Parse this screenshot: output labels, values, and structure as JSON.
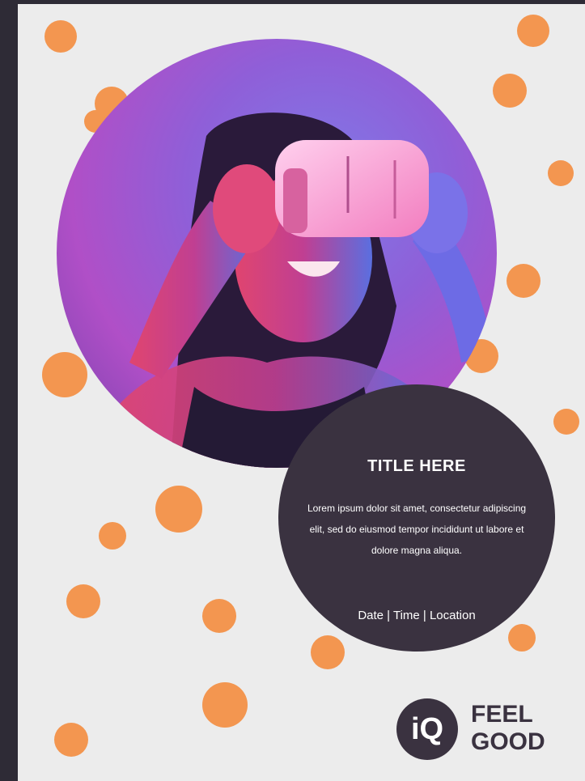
{
  "flyer": {
    "title": "TITLE HERE",
    "body": "Lorem ipsum dolor sit amet, consectetur adipiscing elit, sed do eiusmod tempor incididunt ut labore et dolore magna aliqua.",
    "meta": "Date | Time | Location"
  },
  "brand": {
    "mark": "iQ",
    "line1": "FEEL",
    "line2": "GOOD"
  },
  "colors": {
    "accent_dots": "#f39650",
    "dark_circle": "#3a3240",
    "background": "#ececec",
    "frame": "#2e2b36"
  },
  "icons": {
    "photo": "person-vr-headset-photo",
    "logo": "iq-logo-icon"
  }
}
